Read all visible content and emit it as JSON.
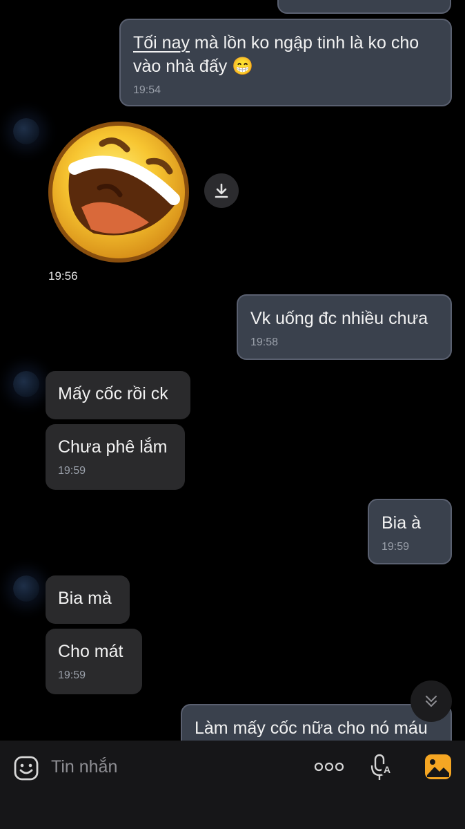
{
  "messages": {
    "m1": {
      "text_underlined": "Tối nay",
      "text_rest": " mà lồn ko ngập tinh là ko cho vào nhà đấy 😁",
      "time": "19:54"
    },
    "sticker": {
      "time": "19:56",
      "icon": "laughing-emoji-sticker"
    },
    "m2": {
      "text": "Vk uống đc nhiều chưa",
      "time": "19:58"
    },
    "m3": {
      "text": "Mấy cốc rồi ck"
    },
    "m4": {
      "text": "Chưa phê lắm",
      "time": "19:59"
    },
    "m5": {
      "text": "Bia à",
      "time": "19:59"
    },
    "m6": {
      "text": "Bia mà"
    },
    "m7": {
      "text": "Cho mát",
      "time": "19:59"
    },
    "m8": {
      "text": "Làm mấy cốc nữa cho nó máu"
    }
  },
  "composer": {
    "placeholder": "Tin nhắn",
    "icons": [
      "emoji-icon",
      "more-icon",
      "voice-to-text-icon",
      "gallery-icon"
    ]
  },
  "colors": {
    "sent_bubble": "#3a414d",
    "received_bubble": "#2a2a2c",
    "background": "#000000",
    "accent": "#f5a623"
  }
}
